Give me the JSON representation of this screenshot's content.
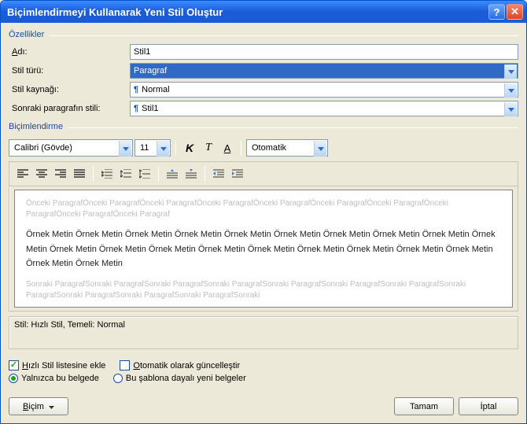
{
  "titlebar": {
    "title": "Biçimlendirmeyi Kullanarak Yeni Stil Oluştur"
  },
  "props": {
    "group": "Özellikler",
    "name_label": "Adı:",
    "name_value": "Stil1",
    "type_label": "Stil türü:",
    "type_value": "Paragraf",
    "source_label": "Stil kaynağı:",
    "source_value": "Normal",
    "next_label": "Sonraki paragrafın stili:",
    "next_value": "Stil1"
  },
  "format": {
    "group": "Biçimlendirme",
    "font_name": "Calibri (Gövde)",
    "font_size": "11",
    "color_label": "Otomatik"
  },
  "preview": {
    "before": "Önceki ParagrafÖnceki ParagrafÖnceki ParagrafÖnceki ParagrafÖnceki ParagrafÖnceki ParagrafÖnceki ParagrafÖnceki ParagrafÖnceki ParagrafÖnceki Paragraf",
    "sample": "Örnek Metin Örnek Metin Örnek Metin Örnek Metin Örnek Metin Örnek Metin Örnek Metin Örnek Metin Örnek Metin Örnek Metin Örnek Metin Örnek Metin Örnek Metin Örnek Metin Örnek Metin Örnek Metin Örnek Metin Örnek Metin Örnek Metin Örnek Metin Örnek Metin",
    "after": "Sonraki ParagrafSonraki ParagrafSonraki ParagrafSonraki ParagrafSonraki ParagrafSonraki ParagrafSonraki ParagrafSonraki ParagrafSonraki ParagrafSonraki ParagrafSonraki ParagrafSonraki"
  },
  "desc": {
    "text": "Stil: Hızlı Stil, Temeli: Normal"
  },
  "opts": {
    "quicklist": "Hızlı Stil listesine ekle",
    "autoupdate": "Otomatik olarak güncelleştir",
    "doc_only": "Yalnızca bu belgede",
    "template": "Bu şablona dayalı yeni belgeler"
  },
  "buttons": {
    "format": "Biçim",
    "ok": "Tamam",
    "cancel": "İptal"
  }
}
